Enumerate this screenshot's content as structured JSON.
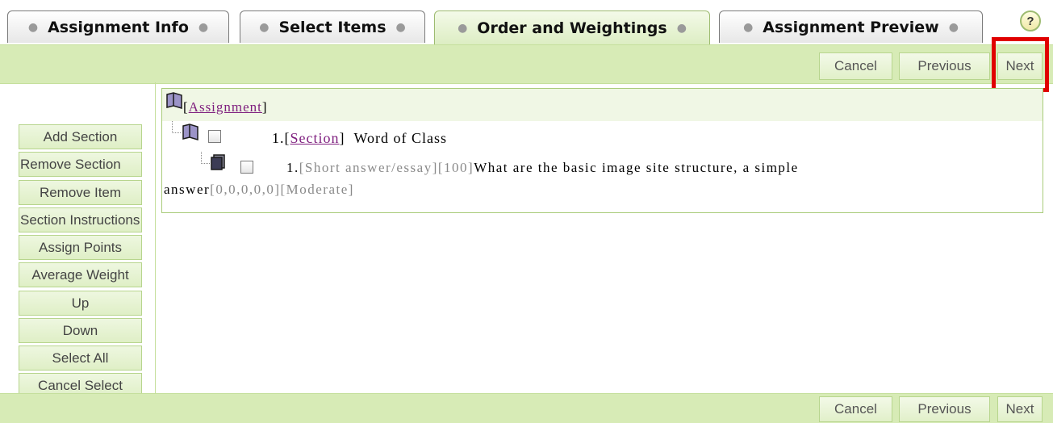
{
  "tabs": [
    {
      "label": "Assignment Info"
    },
    {
      "label": "Select Items"
    },
    {
      "label": "Order and Weightings",
      "active": true
    },
    {
      "label": "Assignment Preview"
    }
  ],
  "help": {
    "label": "?"
  },
  "toolbar": {
    "cancel": "Cancel",
    "previous": "Previous",
    "next": "Next"
  },
  "sidebar": {
    "buttons": [
      "Add Section",
      "Remove Section",
      "Remove Item",
      "Section Instructions",
      "Assign Points",
      "Average Weight",
      "Up",
      "Down",
      "Select All",
      "Cancel Select"
    ]
  },
  "tree": {
    "root": {
      "bracket_open": "[",
      "link": "Assignment",
      "bracket_close": "]"
    },
    "section": {
      "number": "1.",
      "link": "Section",
      "title": "Word of Class"
    },
    "item": {
      "number": "1.",
      "type": "[Short answer/essay][100]",
      "text_line1": "What are the basic image site structure, a simple",
      "text_line2": "answer",
      "meta": "[0,0,0,0,0][Moderate]"
    }
  },
  "colors": {
    "bar": "#d7ebb6",
    "button_border": "#b7d58d",
    "highlight": "#e00000",
    "link": "#7e1e7e"
  }
}
